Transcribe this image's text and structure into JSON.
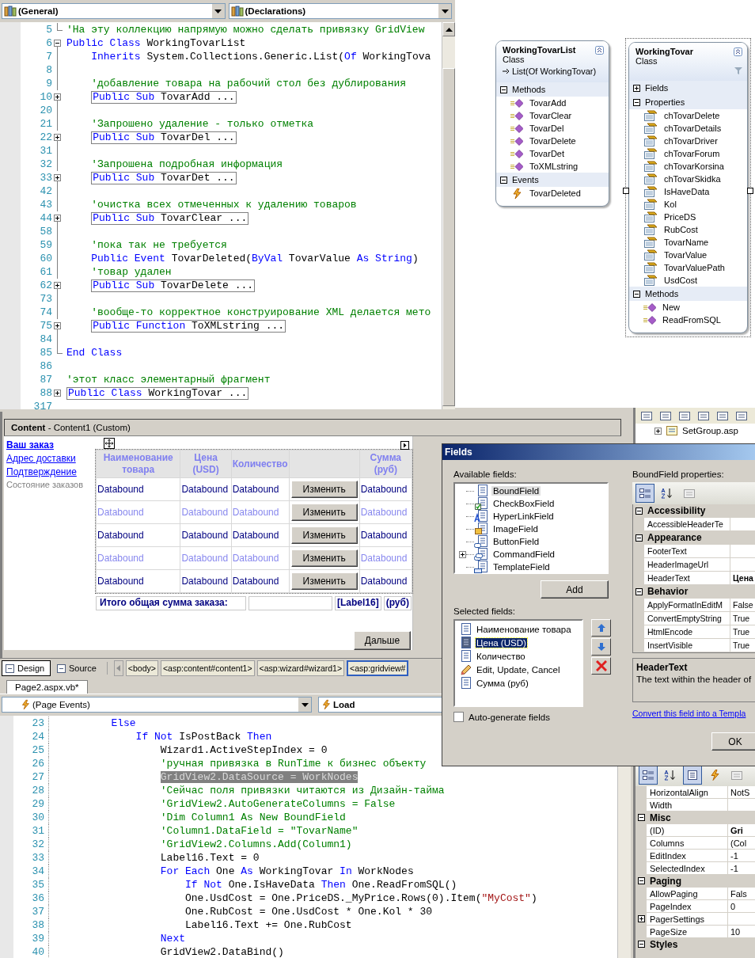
{
  "top_editor": {
    "left_dropdown": "(General)",
    "right_dropdown": "(Declarations)",
    "lines": [
      {
        "num": "5",
        "kind": "end",
        "tokens": [
          {
            "kind": "comment",
            "text": "'На эту коллекцию напрямую можно сделать привязку GridView"
          }
        ]
      },
      {
        "num": "6",
        "kind": "open",
        "tokens": [
          {
            "kind": "keyword",
            "text": "Public Class"
          },
          {
            "kind": "plain",
            "text": " WorkingTovarList"
          }
        ],
        "children": [
          {
            "num": "7",
            "kind": "bar",
            "tokens": [
              {
                "kind": "keyword",
                "text": "Inherits"
              },
              {
                "kind": "plain",
                "text": " System.Collections.Generic.List("
              },
              {
                "kind": "keyword",
                "text": "Of"
              },
              {
                "kind": "plain",
                "text": " WorkingTova"
              }
            ]
          },
          {
            "num": "8",
            "kind": "bar"
          },
          {
            "num": "9",
            "kind": "bar",
            "tokens": [
              {
                "kind": "comment",
                "text": "'добавление товара на рабочий стол без дублирования"
              }
            ]
          },
          {
            "num": "10",
            "kind": "closed",
            "tokens": [
              {
                "kind": "keyword",
                "text": "Public Sub"
              },
              {
                "kind": "plain",
                "text": " TovarAdd ..."
              }
            ]
          },
          {
            "num": "20",
            "kind": "bar"
          },
          {
            "num": "21",
            "kind": "bar",
            "tokens": [
              {
                "kind": "comment",
                "text": "'Запрошено удаление - только отметка"
              }
            ]
          },
          {
            "num": "22",
            "kind": "closed",
            "tokens": [
              {
                "kind": "keyword",
                "text": "Public Sub"
              },
              {
                "kind": "plain",
                "text": " TovarDel ..."
              }
            ]
          },
          {
            "num": "31",
            "kind": "bar"
          },
          {
            "num": "32",
            "kind": "bar",
            "tokens": [
              {
                "kind": "comment",
                "text": "'Запрошена подробная информация"
              }
            ]
          },
          {
            "num": "33",
            "kind": "closed",
            "tokens": [
              {
                "kind": "keyword",
                "text": "Public Sub"
              },
              {
                "kind": "plain",
                "text": " TovarDet ..."
              }
            ]
          },
          {
            "num": "42",
            "kind": "bar"
          },
          {
            "num": "43",
            "kind": "bar",
            "tokens": [
              {
                "kind": "comment",
                "text": "'очистка всех отмеченных к удалению товаров"
              }
            ]
          },
          {
            "num": "44",
            "kind": "closed",
            "tokens": [
              {
                "kind": "keyword",
                "text": "Public Sub"
              },
              {
                "kind": "plain",
                "text": " TovarClear ..."
              }
            ]
          },
          {
            "num": "58",
            "kind": "bar"
          },
          {
            "num": "59",
            "kind": "bar",
            "tokens": [
              {
                "kind": "comment",
                "text": "'пока так не требуется"
              }
            ]
          },
          {
            "num": "60",
            "kind": "bar",
            "tokens": [
              {
                "kind": "keyword",
                "text": "Public Event"
              },
              {
                "kind": "plain",
                "text": " TovarDeleted("
              },
              {
                "kind": "keyword",
                "text": "ByVal"
              },
              {
                "kind": "plain",
                "text": " TovarValue "
              },
              {
                "kind": "keyword",
                "text": "As String"
              },
              {
                "kind": "plain",
                "text": ")"
              }
            ]
          },
          {
            "num": "61",
            "kind": "bar",
            "tokens": [
              {
                "kind": "comment",
                "text": "'товар удален"
              }
            ]
          },
          {
            "num": "62",
            "kind": "closed",
            "tokens": [
              {
                "kind": "keyword",
                "text": "Public Sub"
              },
              {
                "kind": "plain",
                "text": " TovarDelete ..."
              }
            ]
          },
          {
            "num": "73",
            "kind": "bar"
          },
          {
            "num": "74",
            "kind": "bar",
            "tokens": [
              {
                "kind": "comment",
                "text": "'вообще-то корректное конструирование XML делается мето"
              }
            ]
          },
          {
            "num": "75",
            "kind": "closed",
            "tokens": [
              {
                "kind": "keyword",
                "text": "Public Function"
              },
              {
                "kind": "plain",
                "text": " ToXMLstring ..."
              }
            ]
          },
          {
            "num": "84",
            "kind": "bar"
          }
        ]
      },
      {
        "num": "85",
        "kind": "end",
        "tokens": [
          {
            "kind": "keyword",
            "text": "End Class"
          }
        ]
      },
      {
        "num": "86",
        "kind": "plain"
      },
      {
        "num": "87",
        "kind": "plain",
        "tokens": [
          {
            "kind": "comment",
            "text": "'этот класс элементарный фрагмент"
          }
        ]
      },
      {
        "num": "88",
        "kind": "closed",
        "tokens": [
          {
            "kind": "keyword",
            "text": "Public Class"
          },
          {
            "kind": "plain",
            "text": " WorkingTovar ..."
          }
        ]
      },
      {
        "num": "317",
        "kind": "plain"
      }
    ]
  },
  "class_diagram": [
    {
      "name": "WorkingTovarList",
      "type": "Class",
      "base": "List(Of WorkingTovar)",
      "selected": false,
      "sections": [
        {
          "title": "Methods",
          "expanded": true,
          "members": [
            {
              "name": "TovarAdd",
              "kind": "method"
            },
            {
              "name": "TovarClear",
              "kind": "method"
            },
            {
              "name": "TovarDel",
              "kind": "method"
            },
            {
              "name": "TovarDelete",
              "kind": "method"
            },
            {
              "name": "TovarDet",
              "kind": "method"
            },
            {
              "name": "ToXMLstring",
              "kind": "method"
            }
          ]
        },
        {
          "title": "Events",
          "expanded": true,
          "members": [
            {
              "name": "TovarDeleted",
              "kind": "event"
            }
          ]
        }
      ]
    },
    {
      "name": "WorkingTovar",
      "type": "Class",
      "selected": true,
      "sections": [
        {
          "title": "Fields",
          "expanded": false
        },
        {
          "title": "Properties",
          "expanded": true,
          "members": [
            {
              "name": "chTovarDelete",
              "kind": "property"
            },
            {
              "name": "chTovarDetails",
              "kind": "property"
            },
            {
              "name": "chTovarDriver",
              "kind": "property"
            },
            {
              "name": "chTovarForum",
              "kind": "property"
            },
            {
              "name": "chTovarKorsina",
              "kind": "property"
            },
            {
              "name": "chTovarSkidka",
              "kind": "property"
            },
            {
              "name": "IsHaveData",
              "kind": "property"
            },
            {
              "name": "Kol",
              "kind": "property"
            },
            {
              "name": "PriceDS",
              "kind": "property"
            },
            {
              "name": "RubCost",
              "kind": "property"
            },
            {
              "name": "TovarName",
              "kind": "property"
            },
            {
              "name": "TovarValue",
              "kind": "property"
            },
            {
              "name": "TovarValuePath",
              "kind": "property"
            },
            {
              "name": "UsdCost",
              "kind": "property"
            }
          ]
        },
        {
          "title": "Methods",
          "expanded": true,
          "members": [
            {
              "name": "New",
              "kind": "method"
            },
            {
              "name": "ReadFromSQL",
              "kind": "method"
            }
          ]
        }
      ]
    }
  ],
  "solution_explorer": {
    "items": [
      {
        "label": "SetGroup.asp",
        "expanded": false
      }
    ]
  },
  "designer": {
    "header": "**Content** - Content1 (Custom)",
    "nav": [
      {
        "label": "Ваш заказ",
        "selected": true,
        "disabled": false
      },
      {
        "label": "Адрес доставки",
        "selected": false,
        "disabled": false
      },
      {
        "label": "Подтверждение",
        "selected": false,
        "disabled": false
      },
      {
        "label": "Состояние заказов",
        "selected": false,
        "disabled": true
      }
    ],
    "grid": {
      "columns": [
        {
          "kind": "data",
          "label": "Наименование товара"
        },
        {
          "kind": "data",
          "label": "Цена (USD)"
        },
        {
          "kind": "data",
          "label": "Количество"
        },
        {
          "kind": "button"
        },
        {
          "kind": "data",
          "label": "Сумма (руб)"
        }
      ],
      "rows": [
        {
          "alternate": false,
          "cells": [
            "Databound",
            "Databound",
            "Databound",
            "Изменить",
            "Databound"
          ]
        },
        {
          "alternate": true,
          "cells": [
            "Databound",
            "Databound",
            "Databound",
            "Изменить",
            "Databound"
          ]
        },
        {
          "alternate": false,
          "cells": [
            "Databound",
            "Databound",
            "Databound",
            "Изменить",
            "Databound"
          ]
        },
        {
          "alternate": true,
          "cells": [
            "Databound",
            "Databound",
            "Databound",
            "Изменить",
            "Databound"
          ]
        },
        {
          "alternate": false,
          "cells": [
            "Databound",
            "Databound",
            "Databound",
            "Изменить",
            "Databound"
          ]
        }
      ],
      "footer": {
        "label": "Итого общая сумма заказа:",
        "total": "[Label16]",
        "currency": "(руб)"
      }
    },
    "next_button": "Дальше"
  },
  "view_tabs": [
    {
      "label": "Design",
      "selected": true
    },
    {
      "label": "Source",
      "selected": false
    }
  ],
  "breadcrumbs": [
    {
      "label": "<body>",
      "selected": false
    },
    {
      "label": "<asp:content#content1>",
      "selected": false
    },
    {
      "label": "<asp:wizard#wizard1>",
      "selected": false
    },
    {
      "label": "<asp:gridview#",
      "selected": true
    }
  ],
  "bottom_editor": {
    "tab": "Page2.aspx.vb*",
    "left_dropdown": "(Page Events)",
    "right_dropdown": "Load",
    "lines": [
      {
        "num": "23",
        "highlighted": false,
        "tokens": [
          {
            "kind": "keyword",
            "text": "Else"
          }
        ],
        "children": [
          {
            "num": "24",
            "highlighted": false,
            "tokens": [
              {
                "kind": "keyword",
                "text": "If Not"
              },
              {
                "kind": "plain",
                "text": " IsPostBack "
              },
              {
                "kind": "keyword",
                "text": "Then"
              }
            ],
            "children": [
              {
                "num": "25",
                "highlighted": false,
                "tokens": [
                  {
                    "kind": "plain",
                    "text": "Wizard1.ActiveStepIndex = 0"
                  }
                ]
              },
              {
                "num": "26",
                "highlighted": false,
                "tokens": [
                  {
                    "kind": "comment",
                    "text": "'ручная привязка в RunTime к бизнес объекту"
                  }
                ]
              },
              {
                "num": "27",
                "highlighted": true,
                "tokens": [
                  {
                    "kind": "plain",
                    "text": "GridView2.DataSource = WorkNodes"
                  }
                ]
              },
              {
                "num": "28",
                "highlighted": false,
                "tokens": [
                  {
                    "kind": "comment",
                    "text": "'Сейчас поля привязки читаются из Дизайн-тайма"
                  }
                ]
              },
              {
                "num": "29",
                "highlighted": false,
                "tokens": [
                  {
                    "kind": "comment",
                    "text": "'GridView2.AutoGenerateColumns = False"
                  }
                ]
              },
              {
                "num": "30",
                "highlighted": false,
                "tokens": [
                  {
                    "kind": "comment",
                    "text": "'Dim Column1 As New BoundField"
                  }
                ]
              },
              {
                "num": "31",
                "highlighted": false,
                "tokens": [
                  {
                    "kind": "comment",
                    "text": "'Column1.DataField = \"TovarName\""
                  }
                ]
              },
              {
                "num": "32",
                "highlighted": false,
                "tokens": [
                  {
                    "kind": "comment",
                    "text": "'GridView2.Columns.Add(Column1)"
                  }
                ]
              },
              {
                "num": "33",
                "highlighted": false,
                "tokens": [
                  {
                    "kind": "plain",
                    "text": "Label16.Text = 0"
                  }
                ]
              },
              {
                "num": "34",
                "highlighted": false,
                "tokens": [
                  {
                    "kind": "keyword",
                    "text": "For Each"
                  },
                  {
                    "kind": "plain",
                    "text": " One "
                  },
                  {
                    "kind": "keyword",
                    "text": "As"
                  },
                  {
                    "kind": "plain",
                    "text": " WorkingTovar "
                  },
                  {
                    "kind": "keyword",
                    "text": "In"
                  },
                  {
                    "kind": "plain",
                    "text": " WorkNodes"
                  }
                ],
                "children": [
                  {
                    "num": "35",
                    "highlighted": false,
                    "tokens": [
                      {
                        "kind": "keyword",
                        "text": "If Not"
                      },
                      {
                        "kind": "plain",
                        "text": " One.IsHaveData "
                      },
                      {
                        "kind": "keyword",
                        "text": "Then"
                      },
                      {
                        "kind": "plain",
                        "text": " One.ReadFromSQL()"
                      }
                    ]
                  },
                  {
                    "num": "36",
                    "highlighted": false,
                    "tokens": [
                      {
                        "kind": "plain",
                        "text": "One.UsdCost = One.PriceDS._MyPrice.Rows(0).Item("
                      },
                      {
                        "kind": "string",
                        "text": "\"MyCost\""
                      },
                      {
                        "kind": "plain",
                        "text": ")"
                      }
                    ]
                  },
                  {
                    "num": "37",
                    "highlighted": false,
                    "tokens": [
                      {
                        "kind": "plain",
                        "text": "One.RubCost = One.UsdCost * One.Kol * 30"
                      }
                    ]
                  },
                  {
                    "num": "38",
                    "highlighted": false,
                    "tokens": [
                      {
                        "kind": "plain",
                        "text": "Label16.Text += One.RubCost"
                      }
                    ]
                  }
                ]
              },
              {
                "num": "39",
                "highlighted": false,
                "tokens": [
                  {
                    "kind": "keyword",
                    "text": "Next"
                  }
                ]
              },
              {
                "num": "40",
                "highlighted": false,
                "tokens": [
                  {
                    "kind": "plain",
                    "text": "GridView2.DataBind()"
                  }
                ]
              }
            ]
          }
        ]
      }
    ]
  },
  "fields_dialog": {
    "title": "Fields",
    "available_label": "Available fields:",
    "available": [
      {
        "name": "BoundField",
        "kind": "bound",
        "selected": true
      },
      {
        "name": "CheckBoxField",
        "kind": "checkbox",
        "selected": false
      },
      {
        "name": "HyperLinkField",
        "kind": "hyperlink",
        "selected": false
      },
      {
        "name": "ImageField",
        "kind": "image",
        "selected": false
      },
      {
        "name": "ButtonField",
        "kind": "button",
        "selected": false
      },
      {
        "name": "CommandField",
        "kind": "command",
        "selected": false
      },
      {
        "name": "TemplateField",
        "kind": "template",
        "selected": false
      }
    ],
    "add_button": "Add",
    "selected_label": "Selected fields:",
    "selected_fields": [
      {
        "name": "Наименование товара",
        "kind": "bound",
        "selected": false
      },
      {
        "name": "Цена (USD)",
        "kind": "bound",
        "selected": true
      },
      {
        "name": "Количество",
        "kind": "bound",
        "selected": false
      },
      {
        "name": "Edit, Update, Cancel",
        "kind": "command",
        "selected": false
      },
      {
        "name": "Сумма (руб)",
        "kind": "bound",
        "selected": false
      }
    ],
    "auto_generate": {
      "label": "Auto-generate fields",
      "checked": false
    },
    "properties_label": "BoundField properties:",
    "properties": [
      {
        "kind": "category",
        "name": "Accessibility",
        "expanded": true
      },
      {
        "kind": "prop",
        "name": "AccessibleHeaderTe"
      },
      {
        "kind": "category",
        "name": "Appearance",
        "expanded": true
      },
      {
        "kind": "prop",
        "name": "FooterText"
      },
      {
        "kind": "prop",
        "name": "HeaderImageUrl"
      },
      {
        "kind": "prop",
        "name": "HeaderText",
        "value": "Цена",
        "modified": true
      },
      {
        "kind": "category",
        "name": "Behavior",
        "expanded": true
      },
      {
        "kind": "prop",
        "name": "ApplyFormatInEditM",
        "value": "False",
        "modified": false
      },
      {
        "kind": "prop",
        "name": "ConvertEmptyString",
        "value": "True",
        "modified": false
      },
      {
        "kind": "prop",
        "name": "HtmlEncode",
        "value": "True",
        "modified": false
      },
      {
        "kind": "prop",
        "name": "InsertVisible",
        "value": "True",
        "modified": false
      }
    ],
    "description": {
      "title": "HeaderText",
      "text": "The text within the header of"
    },
    "convert_link": "Convert this field into a Templa",
    "ok_button": "OK"
  },
  "properties_panel": {
    "rows": [
      {
        "kind": "prop",
        "name": "HorizontalAlign",
        "value": "NotS",
        "modified": false
      },
      {
        "kind": "prop",
        "name": "Width"
      },
      {
        "kind": "category",
        "name": "Misc",
        "expanded": true
      },
      {
        "kind": "prop",
        "name": "(ID)",
        "value": "Gri",
        "modified": true
      },
      {
        "kind": "prop",
        "name": "Columns",
        "value": "(Col",
        "modified": false
      },
      {
        "kind": "prop",
        "name": "EditIndex",
        "value": "-1",
        "modified": false
      },
      {
        "kind": "prop",
        "name": "SelectedIndex",
        "value": "-1",
        "modified": false
      },
      {
        "kind": "category",
        "name": "Paging",
        "expanded": true
      },
      {
        "kind": "prop",
        "name": "AllowPaging",
        "value": "Fals",
        "modified": false
      },
      {
        "kind": "prop",
        "name": "PageIndex",
        "value": "0",
        "modified": false
      },
      {
        "kind": "group",
        "name": "PagerSettings",
        "expanded": false
      },
      {
        "kind": "prop",
        "name": "PageSize",
        "value": "10",
        "modified": false
      },
      {
        "kind": "category",
        "name": "Styles",
        "expanded": true
      }
    ]
  }
}
